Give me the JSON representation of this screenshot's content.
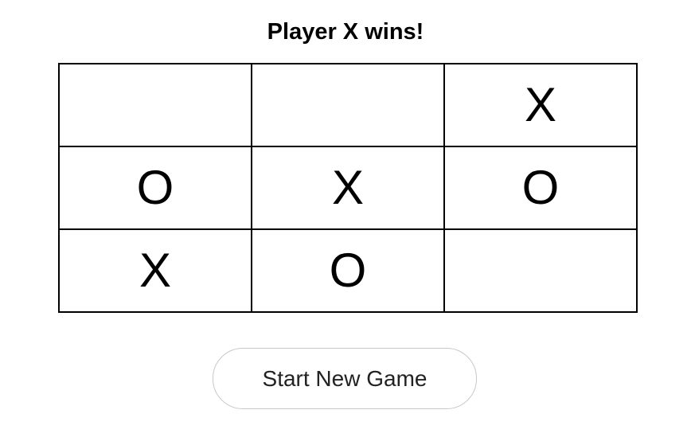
{
  "status": "Player X wins!",
  "board": [
    [
      "",
      "",
      "X"
    ],
    [
      "O",
      "X",
      "O"
    ],
    [
      "X",
      "O",
      ""
    ]
  ],
  "new_game_label": "Start New Game"
}
